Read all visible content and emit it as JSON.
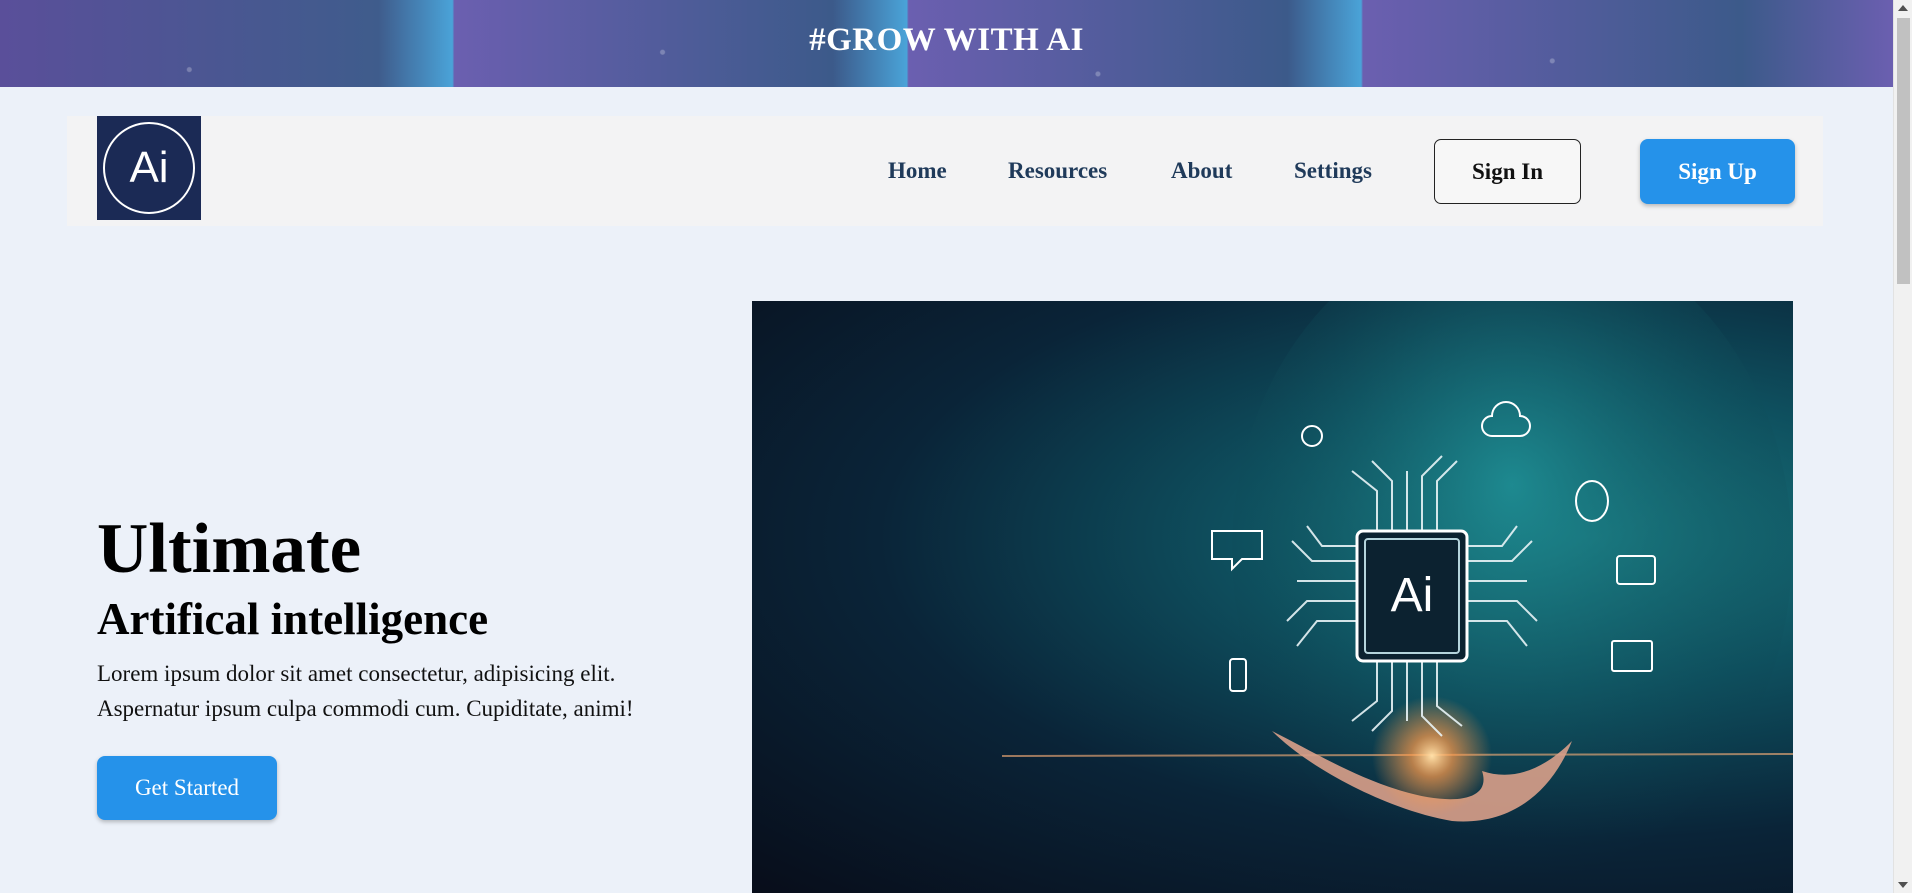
{
  "banner": {
    "title": "#GROW WITH AI"
  },
  "nav": {
    "logo_text": "Ai",
    "links": [
      {
        "label": "Home"
      },
      {
        "label": "Resources"
      },
      {
        "label": "About"
      },
      {
        "label": "Settings"
      }
    ],
    "signin_label": "Sign In",
    "signup_label": "Sign Up"
  },
  "hero": {
    "title": "Ultimate",
    "subtitle": "Artifical intelligence",
    "text_line1": "Lorem ipsum dolor sit amet consectetur, adipisicing elit.",
    "text_line2": "Aspernatur ipsum culpa commodi cum. Cupiditate, animi!",
    "cta_label": "Get Started",
    "image_chip_text": "Ai"
  },
  "colors": {
    "accent": "#2592ea",
    "nav_text": "#1f3a5a",
    "logo_bg": "#1b2a55",
    "page_bg": "#ecf1f9"
  }
}
